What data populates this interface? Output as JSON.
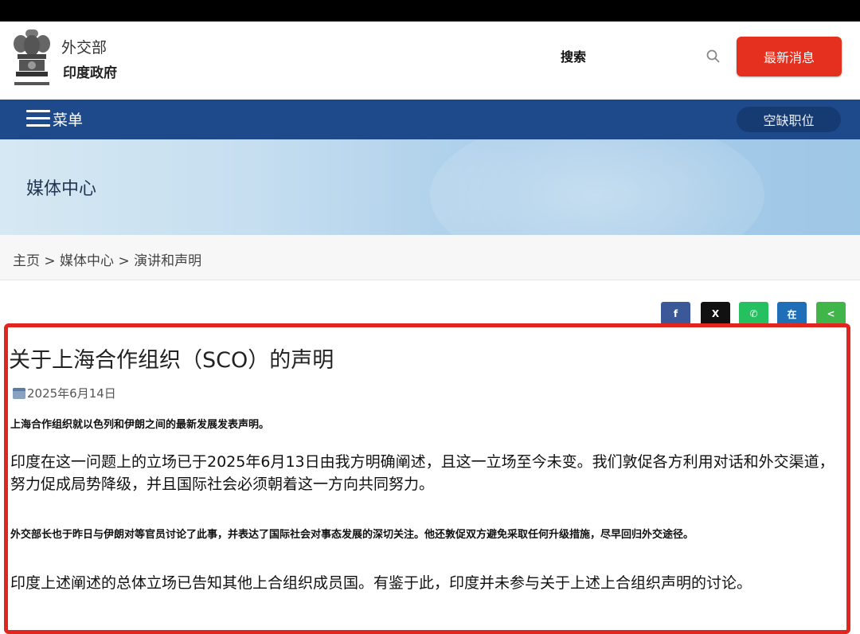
{
  "header": {
    "ministry": "外交部",
    "government": "印度政府",
    "emblem_caption": "सत्यमेव जयते",
    "search_label": "搜索",
    "news_button": "最新消息"
  },
  "nav": {
    "menu_label": "菜单",
    "jobs_button": "空缺职位"
  },
  "banner": {
    "title": "媒体中心"
  },
  "breadcrumb": "主页 > 媒体中心 > 演讲和声明",
  "share_buttons": [
    {
      "icon": "facebook-icon",
      "glyph": "f",
      "color": "#3b5998"
    },
    {
      "icon": "x-icon",
      "glyph": "X",
      "color": "#111111"
    },
    {
      "icon": "whatsapp-icon",
      "glyph": "✆",
      "color": "#25c161"
    },
    {
      "icon": "linkedin-icon",
      "glyph": "在",
      "color": "#1e6fb8"
    },
    {
      "icon": "share-icon",
      "glyph": "<",
      "color": "#3fb54a"
    }
  ],
  "article": {
    "title": "关于上海合作组织（SCO）的声明",
    "date": "2025年6月14日",
    "para1": "上海合作组织就以色列和伊朗之间的最新发展发表声明。",
    "para2": "印度在这一问题上的立场已于2025年6月13日由我方明确阐述，且这一立场至今未变。我们敦促各方利用对话和外交渠道，努力促成局势降级，并且国际社会必须朝着这一方向共同努力。",
    "para3": "外交部长也于昨日与伊朗对等官员讨论了此事，并表达了国际社会对事态发展的深切关注。他还敦促双方避免采取任何升级措施，尽早回归外交途径。",
    "para4": "印度上述阐述的总体立场已告知其他上合组织成员国。有鉴于此，印度并未参与关于上述上合组织声明的讨论。"
  },
  "colors": {
    "nav_blue": "#1e4a8c",
    "news_red": "#e5301f",
    "highlight_red": "#e0261f"
  }
}
